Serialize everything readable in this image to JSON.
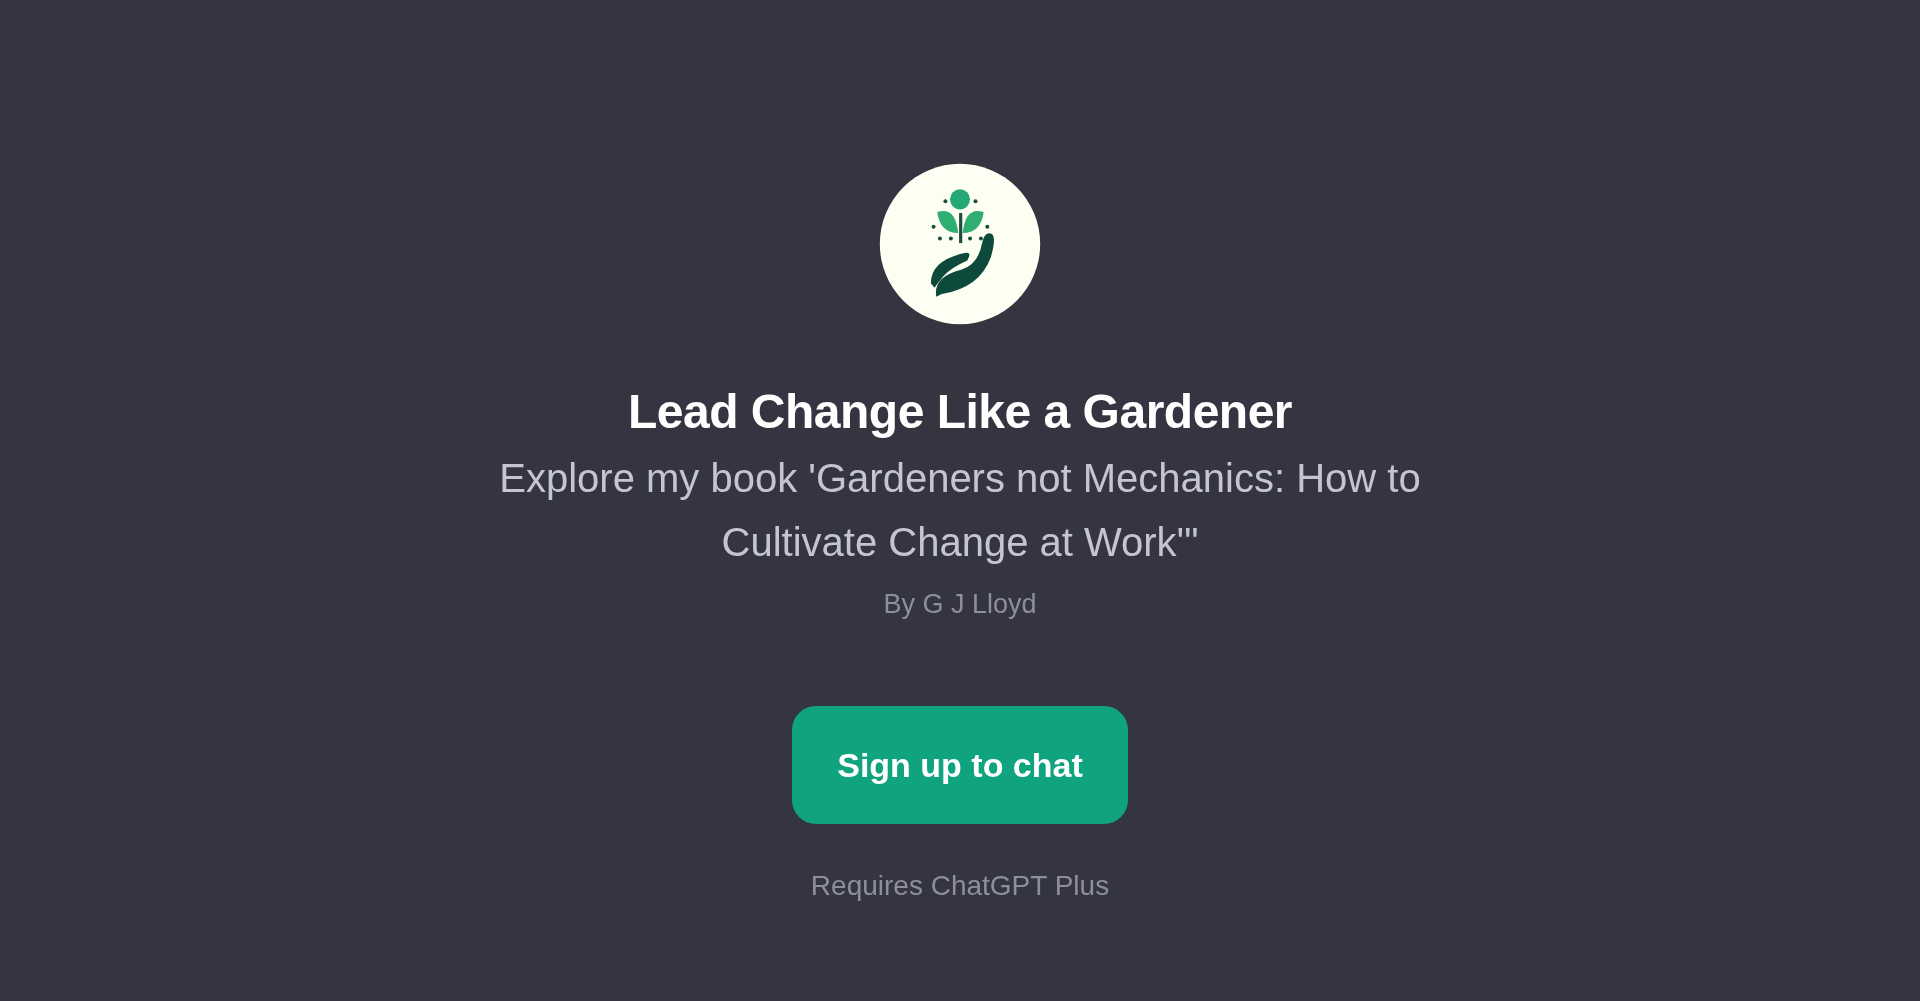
{
  "gpt": {
    "title": "Lead Change Like a Gardener",
    "description": "Explore my book 'Gardeners not Mechanics: How to Cultivate Change at Work'\"",
    "author": "By G J Lloyd"
  },
  "signup_button": {
    "label": "Sign up to chat"
  },
  "note": "Requires ChatGPT Plus"
}
